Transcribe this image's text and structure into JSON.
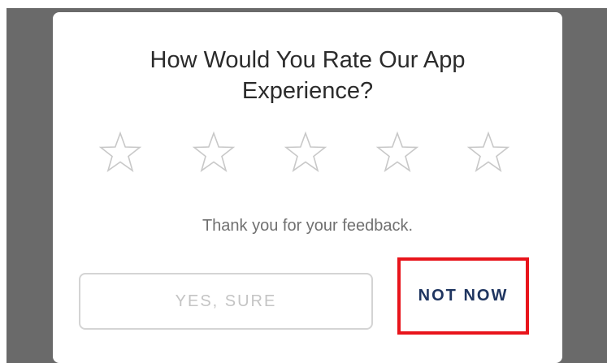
{
  "dialog": {
    "title_line1": "How Would You Rate Our App",
    "title_line2": "Experience?",
    "rating": {
      "max_stars": 5,
      "selected": 0,
      "star_icon": "star-outline-icon",
      "star_color": "#c8c8c8"
    },
    "feedback_text": "Thank you for your feedback.",
    "buttons": {
      "yes_label": "YES, SURE",
      "not_now_label": "NOT NOW"
    },
    "highlight_color": "#e8141b",
    "accent_color": "#1f3560"
  }
}
